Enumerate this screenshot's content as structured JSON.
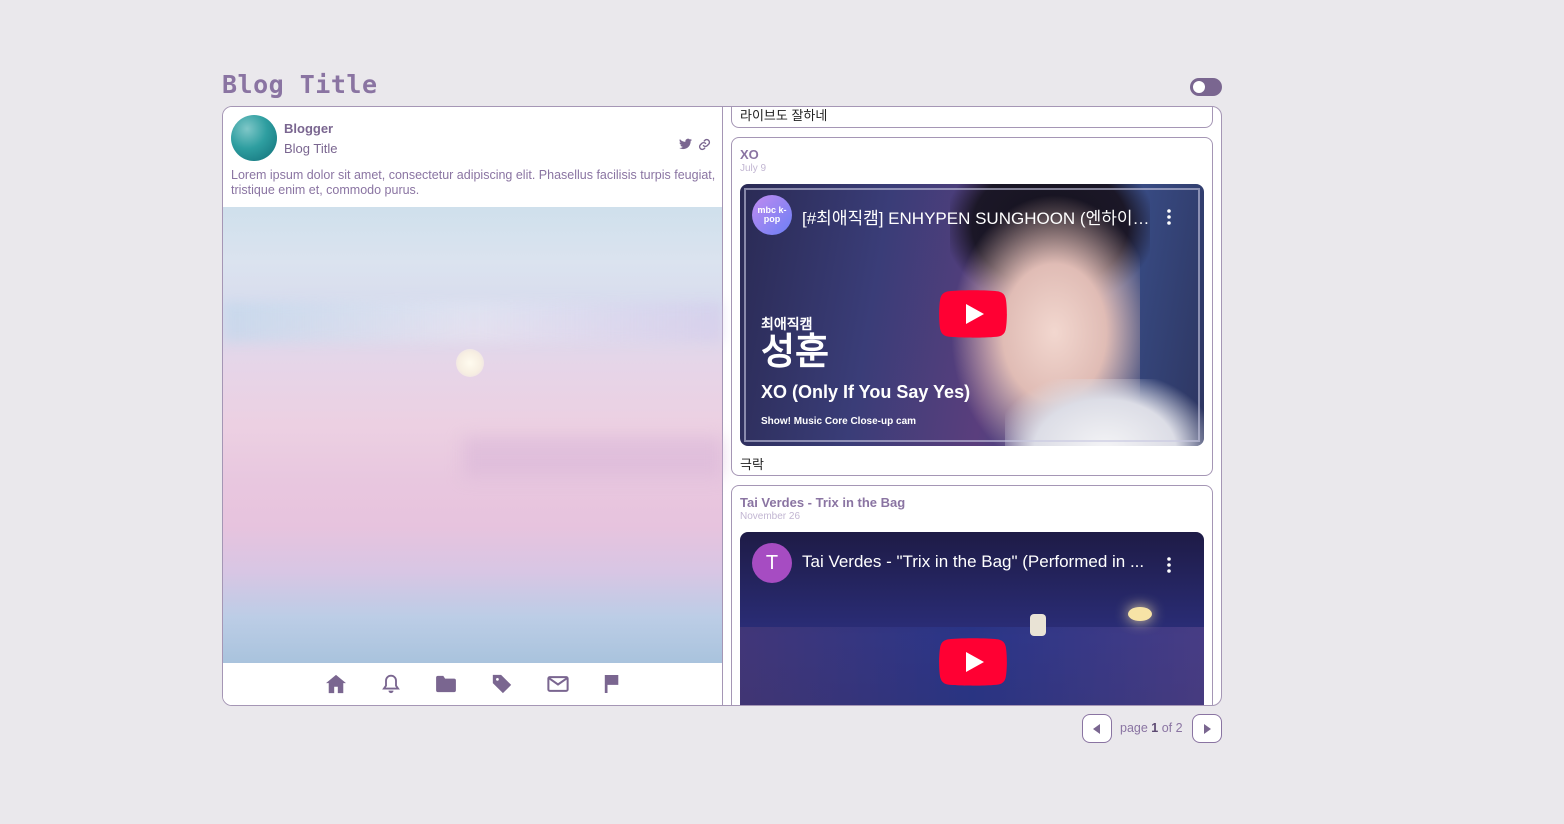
{
  "header": {
    "title": "Blog Title"
  },
  "sidebar": {
    "name": "Blogger",
    "subtitle": "Blog Title",
    "description": "Lorem ipsum dolor sit amet, consectetur adipiscing elit. Phasellus facilisis turpis feugiat, tristique enim et, commodo purus."
  },
  "posts": [
    {
      "text": "라이브도 잘하네"
    },
    {
      "title": "XO",
      "date": "July 9",
      "video_title": "[#최애직캠] ENHYPEN SUNGHOON (엔하이픈 성훈) - XO (Only If You Say Yes)",
      "channel": "mbc k-pop",
      "overlay_tag": "최애직캠",
      "overlay_name": "성훈",
      "overlay_song": "XO (Only If You Say Yes)",
      "overlay_show": "Show! Music Core Close-up cam",
      "caption": "극락"
    },
    {
      "title": "Tai Verdes - Trix in the Bag",
      "date": "November 26",
      "video_title": "Tai Verdes - \"Trix in the Bag\" (Performed in ...",
      "channel_initial": "T"
    }
  ],
  "pagination": {
    "prefix": "page",
    "current": "1",
    "of": "of",
    "total": "2"
  },
  "colors": {
    "accent": "#7a6690",
    "background": "#eae8ec",
    "youtube_red": "#ff0033"
  }
}
